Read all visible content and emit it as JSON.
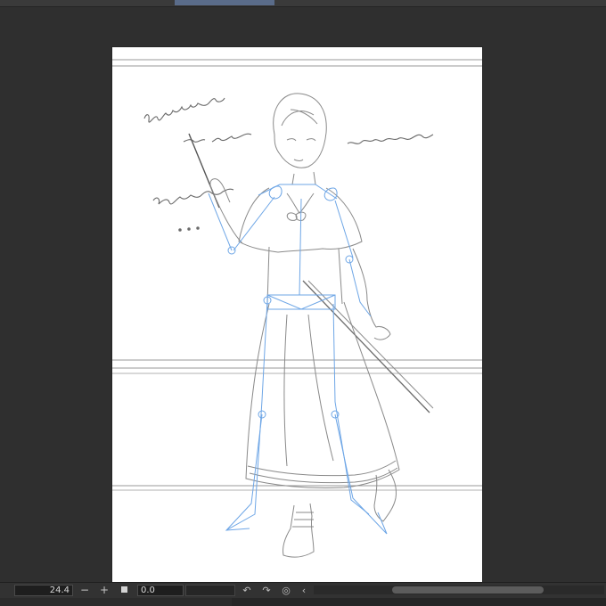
{
  "statusbar": {
    "zoom_value": "24.4",
    "zoom_out_label": "−",
    "zoom_in_label": "+",
    "angle_value": "0.0",
    "icons": {
      "fit": "square-fit-icon",
      "rotate_left": "rotate-left-icon",
      "rotate_right": "rotate-right-icon",
      "reset_rotation": "reset-rotation-icon",
      "flip": "flip-icon"
    }
  },
  "colors": {
    "workspace": "#2f2f2f",
    "paper": "#ffffff",
    "sketch_line": "#8a8a8a",
    "guide_line": "#6ea6e6"
  }
}
